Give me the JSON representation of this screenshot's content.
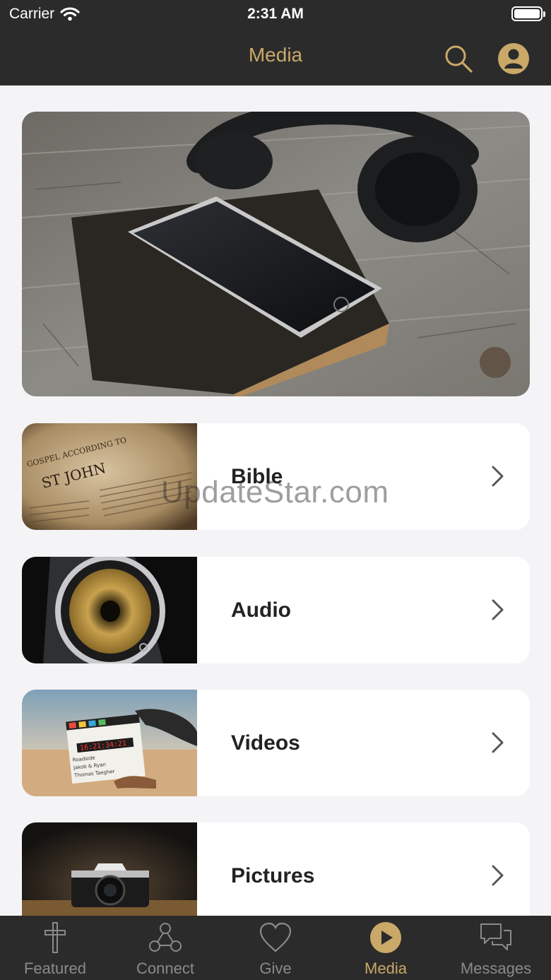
{
  "status_bar": {
    "carrier": "Carrier",
    "time": "2:31 AM"
  },
  "header": {
    "title": "Media"
  },
  "hero": {
    "image": "headphones-phone-bible-photo"
  },
  "categories": [
    {
      "label": "Bible",
      "thumb_text_1": "GOSPEL ACCORDING TO",
      "thumb_text_2": "ST JOHN"
    },
    {
      "label": "Audio"
    },
    {
      "label": "Videos",
      "clapper_digits": "16:21:34:21",
      "clapper_line_1": "Roadside",
      "clapper_line_2": "Jakob & Ryan",
      "clapper_line_3": "Thomas Taegher"
    },
    {
      "label": "Pictures"
    }
  ],
  "watermark": "UpdateStar.com",
  "tabbar": {
    "items": [
      {
        "label": "Featured",
        "icon": "cross-icon"
      },
      {
        "label": "Connect",
        "icon": "connect-icon"
      },
      {
        "label": "Give",
        "icon": "heart-icon"
      },
      {
        "label": "Media",
        "icon": "play-icon",
        "active": true
      },
      {
        "label": "Messages",
        "icon": "chat-icon"
      }
    ]
  },
  "colors": {
    "accent": "#c9a868",
    "bar": "#2b2b2b",
    "background": "#f4f4f6"
  }
}
